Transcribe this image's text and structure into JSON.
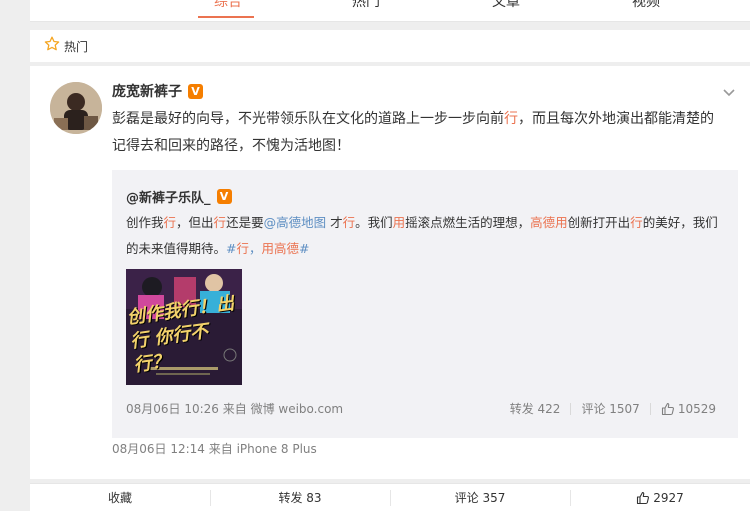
{
  "tabs": [
    {
      "label": "综合",
      "active": true
    },
    {
      "label": "热门",
      "active": false
    },
    {
      "label": "文章",
      "active": false
    },
    {
      "label": "视频",
      "active": false
    }
  ],
  "hot_section": {
    "label": "热门",
    "icon": "star-icon"
  },
  "post": {
    "author": "庞宽新裤子",
    "verified_badge": "V",
    "text_parts": [
      {
        "t": "彭磊是最好的向导，不光带领乐队在文化的道路上一步一步向前",
        "c": "normal"
      },
      {
        "t": "行",
        "c": "hl"
      },
      {
        "t": "，而且每次外地演出都能清楚的记得去和回来的路径，不愧为活地图！",
        "c": "normal"
      }
    ],
    "time_source": "08月06日 12:14  来自 iPhone 8 Plus"
  },
  "repost": {
    "author": "@新裤子乐队_",
    "verified_badge": "V",
    "text_parts": [
      {
        "t": "创作我",
        "c": "normal"
      },
      {
        "t": "行",
        "c": "hl"
      },
      {
        "t": "，但出",
        "c": "normal"
      },
      {
        "t": "行",
        "c": "hl"
      },
      {
        "t": "还是要",
        "c": "normal"
      },
      {
        "t": "@高德地图",
        "c": "link"
      },
      {
        "t": " 才",
        "c": "normal"
      },
      {
        "t": "行",
        "c": "hl"
      },
      {
        "t": "。我们",
        "c": "normal"
      },
      {
        "t": "用",
        "c": "hl"
      },
      {
        "t": "摇滚点燃生活的理想，",
        "c": "normal"
      },
      {
        "t": "高德用",
        "c": "hl"
      },
      {
        "t": "创新打开出",
        "c": "normal"
      },
      {
        "t": "行",
        "c": "hl"
      },
      {
        "t": "的美好，我们的未来值得期待。",
        "c": "normal"
      },
      {
        "t": "#",
        "c": "link"
      },
      {
        "t": "行",
        "c": "hl"
      },
      {
        "t": "，",
        "c": "link"
      },
      {
        "t": "用高德",
        "c": "hl"
      },
      {
        "t": "#",
        "c": "link"
      }
    ],
    "image_caption": "创作我行！出行 你行不行？",
    "time_source": "08月06日 10:26  来自 微博 weibo.com",
    "repost_label": "转发 422",
    "comment_label": "评论 1507",
    "like_count": "10529"
  },
  "actions": {
    "favorite": "收藏",
    "repost": "转发 83",
    "comment": "评论 357",
    "like": "2927"
  },
  "colors": {
    "accent": "#eb7350",
    "link": "#5d8ec2",
    "badge": "#f57e00"
  }
}
